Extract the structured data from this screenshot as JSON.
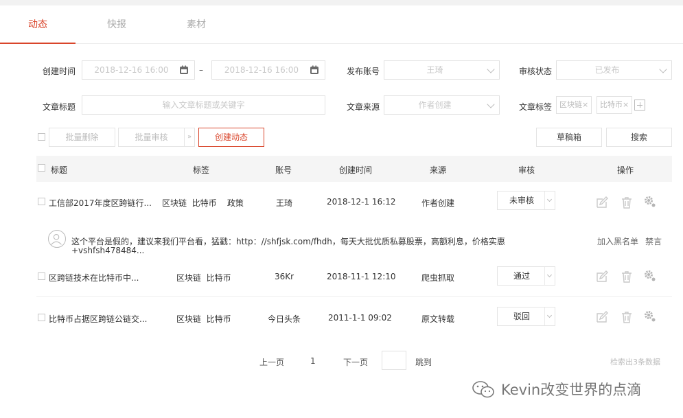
{
  "tabs": [
    "动态",
    "快报",
    "素材"
  ],
  "filters": {
    "create_time_label": "创建时间",
    "date_start": "2018-12-16 16:00",
    "date_sep": "–",
    "date_end": "2018-12-16 16:00",
    "account_label": "发布账号",
    "account_value": "王琦",
    "review_label": "审核状态",
    "review_value": "已发布",
    "title_label": "文章标题",
    "title_placeholder": "输入文章标题或关键字",
    "source_label": "文章来源",
    "source_value": "作者创建",
    "tags_label": "文章标签",
    "tags": [
      "区块链×",
      "比特币×"
    ]
  },
  "toolbar": {
    "batch_delete": "批量删除",
    "batch_review": "批量审核",
    "batch_review_arrow": "»",
    "create": "创建动态",
    "drafts": "草稿箱",
    "search": "搜索"
  },
  "columns": [
    "标题",
    "标签",
    "账号",
    "创建时间",
    "来源",
    "审核",
    "操作"
  ],
  "rows": [
    {
      "title": "工信部2017年度区跨链行...",
      "tags": "区块链  比特币    政策",
      "account": "王琦",
      "time": "2018-12-1 16:12",
      "source": "作者创建",
      "review": "未审核"
    },
    {
      "title": "区跨链技术在比特币中...",
      "tags": "区块链  比特币",
      "account": "36Kr",
      "time": "2018-11-1 12:10",
      "source": "爬虫抓取",
      "review": "通过"
    },
    {
      "title": "比特币占据区跨链公链交...",
      "tags": "区块链  比特币",
      "account": "今日头条",
      "time": "2011-1-1 09:02",
      "source": "原文转载",
      "review": "驳回"
    }
  ],
  "comment": {
    "line1": "这个平台是假的，建议来我们平台看，猛戳：http：//shfjsk.com/fhdh，每天大批优质私募股票，高额利息，价格实惠",
    "line2": "+vshfsh478484...",
    "blacklist": "加入黑名单",
    "mute": "禁言"
  },
  "pagination": {
    "prev": "上一页",
    "page": "1",
    "next": "下一页",
    "jump": "跳到",
    "result": "检索出3条数据"
  },
  "watermark": "Kevin改变世界的点滴",
  "colors": {
    "accent": "#d9452b"
  }
}
